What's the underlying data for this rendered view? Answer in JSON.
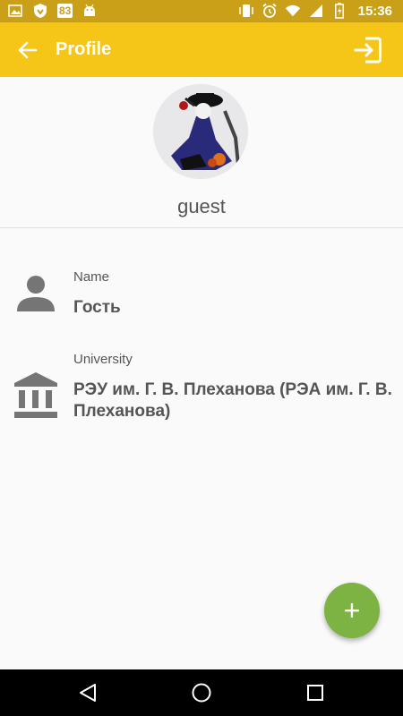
{
  "status_bar": {
    "time": "15:36",
    "badge": "83",
    "icons": [
      "image-icon",
      "shield-icon",
      "android-icon",
      "vibrate-icon",
      "alarm-icon",
      "wifi-icon",
      "signal-icon",
      "battery-icon"
    ]
  },
  "app_bar": {
    "title": "Profile",
    "back_icon": "arrow-left-icon",
    "action_icon": "exit-icon"
  },
  "profile": {
    "username": "guest"
  },
  "fields": [
    {
      "label": "Name",
      "value": "Гость",
      "icon": "person-icon"
    },
    {
      "label": "University",
      "value": "РЭУ им. Г. В. Плеханова (РЭА им. Г. В. Плеханова)",
      "icon": "bank-icon"
    }
  ],
  "fab": {
    "symbol": "+",
    "color": "#7cb342"
  },
  "nav_bar": [
    "back-triangle-icon",
    "home-circle-icon",
    "recents-square-icon"
  ],
  "colors": {
    "app_bar": "#f5c518",
    "status_bar": "#c9a017",
    "text": "#555555"
  }
}
